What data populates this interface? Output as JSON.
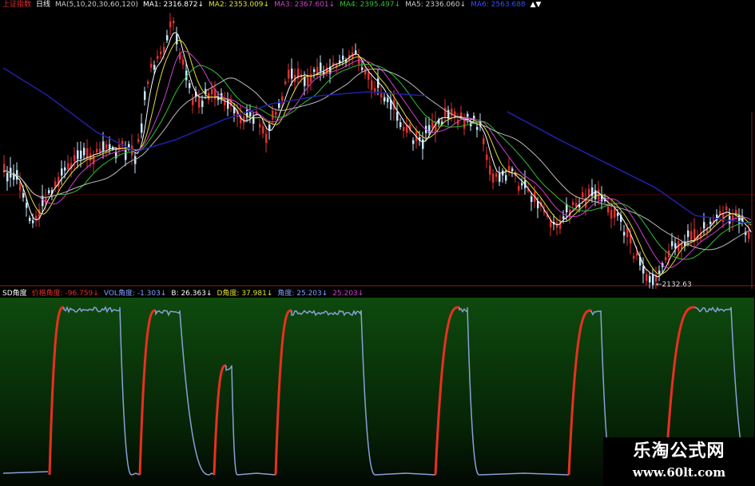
{
  "main_header": {
    "items": [
      {
        "text": "上证指数",
        "color": "#e03030"
      },
      {
        "text": "日线",
        "color": "#ffffff"
      },
      {
        "text": "MA(5,10,20,30,60,120)",
        "color": "#cccccc"
      },
      {
        "text": "MA1: 2316.872↓",
        "color": "#ffffff"
      },
      {
        "text": "MA2: 2353.009↓",
        "color": "#e0e030"
      },
      {
        "text": "MA3: 2367.601↓",
        "color": "#d040d0"
      },
      {
        "text": "MA4: 2395.497↓",
        "color": "#30c030"
      },
      {
        "text": "MA5: 2336.060↓",
        "color": "#cccccc"
      },
      {
        "text": "MA6: 2563.688",
        "color": "#3050ff"
      }
    ],
    "scroll_arrows": "▲▼"
  },
  "indicator_header": {
    "items": [
      {
        "text": "SD角度",
        "color": "#ffffff"
      },
      {
        "text": "价格角度: -96.759↓",
        "color": "#e03030"
      },
      {
        "text": "VOL角度: -1.303↓",
        "color": "#80a0ff"
      },
      {
        "text": "B: 26.363↓",
        "color": "#ffffff"
      },
      {
        "text": "D角度: 37.981↓",
        "color": "#e0e030"
      },
      {
        "text": "角度: 25.203↓",
        "color": "#80a0ff"
      },
      {
        "text": "25.203↓",
        "color": "#d040d0"
      }
    ]
  },
  "low_marker": "←2132.63",
  "watermark": {
    "title": "乐淘公式网",
    "url": "www.60lt.com"
  },
  "colors": {
    "candle_up": "#e03030",
    "candle_down": "#c8e8ff",
    "ma_white": "#ffffff",
    "ma_yellow": "#e0e030",
    "ma_magenta": "#d040d0",
    "ma_green": "#30c030",
    "ma_gray": "#bbbbbb",
    "ma_blue": "#2020a0",
    "indicator_red": "#e83020",
    "indicator_blue": "#8aa0d8"
  }
}
